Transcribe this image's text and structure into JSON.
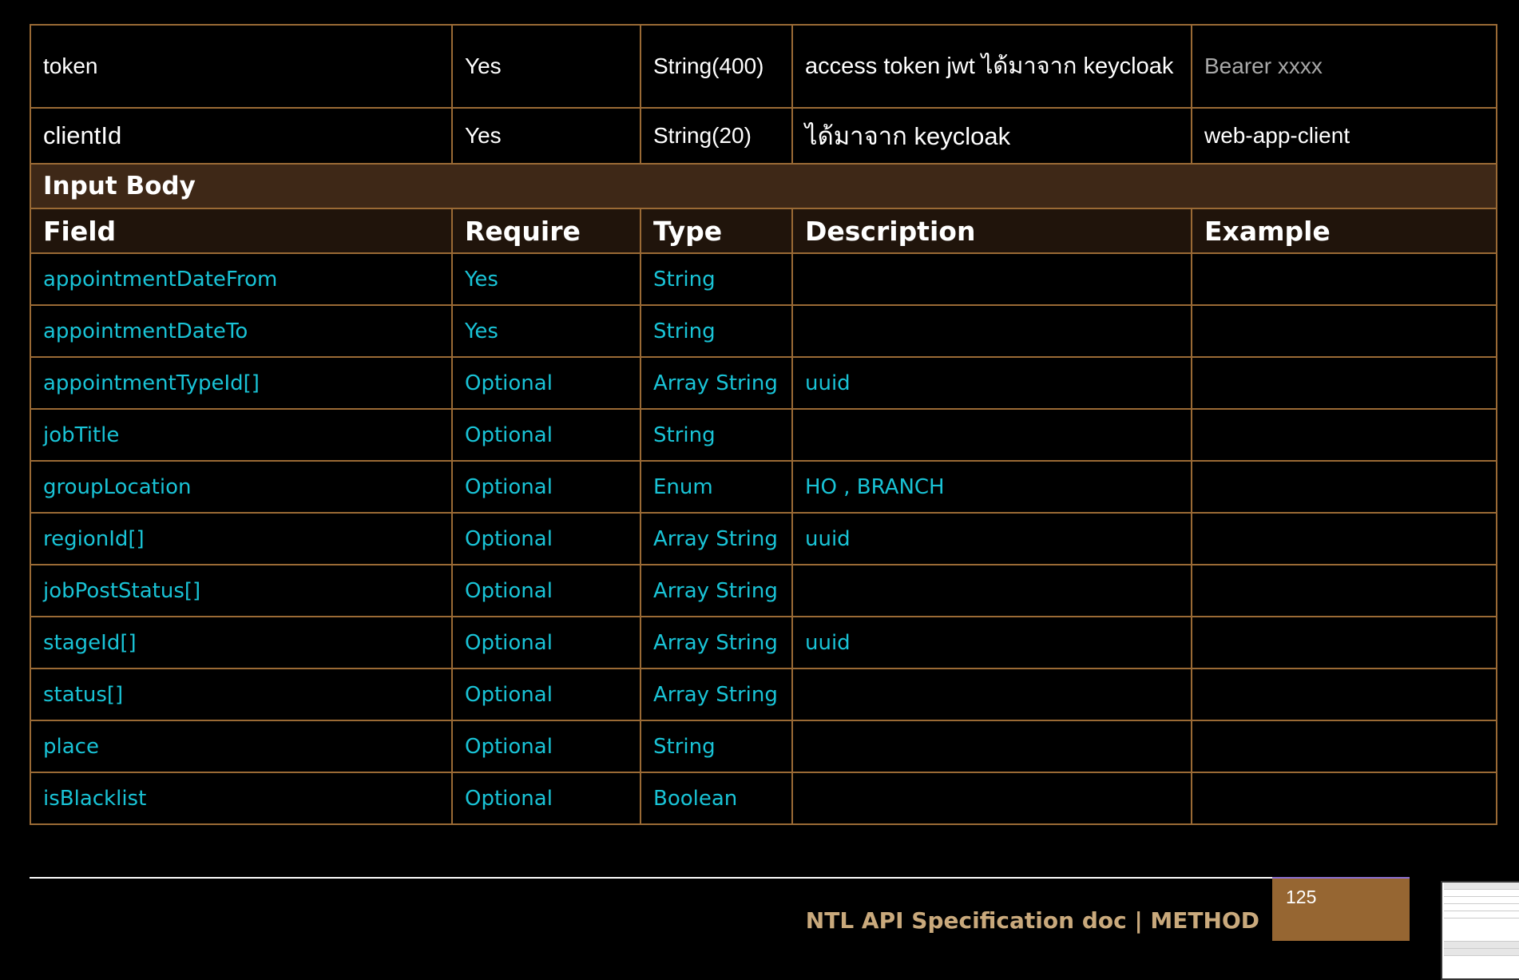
{
  "header_rows": [
    {
      "field": "token",
      "require": "Yes",
      "type": "String(400)",
      "description": "access token jwt ได้มาจาก keycloak",
      "example": "Bearer xxxx"
    },
    {
      "field": "clientId",
      "require": "Yes",
      "type": "String(20)",
      "description": "ได้มาจาก keycloak",
      "example": "web-app-client"
    }
  ],
  "section_title": "Input Body",
  "columns": {
    "field": "Field",
    "require": "Require",
    "type": "Type",
    "description": "Description",
    "example": "Example"
  },
  "rows": [
    {
      "field": "appointmentDateFrom",
      "require": "Yes",
      "type": "String",
      "description": "",
      "example": ""
    },
    {
      "field": "appointmentDateTo",
      "require": "Yes",
      "type": "String",
      "description": "",
      "example": ""
    },
    {
      "field": "appointmentTypeId[]",
      "require": "Optional",
      "type": "Array String",
      "description": "uuid",
      "example": ""
    },
    {
      "field": "jobTitle",
      "require": "Optional",
      "type": "String",
      "description": "",
      "example": ""
    },
    {
      "field": "groupLocation",
      "require": "Optional",
      "type": "Enum",
      "description": "HO , BRANCH",
      "example": ""
    },
    {
      "field": "regionId[]",
      "require": "Optional",
      "type": "Array String",
      "description": "uuid",
      "example": ""
    },
    {
      "field": "jobPostStatus[]",
      "require": "Optional",
      "type": "Array String",
      "description": "",
      "example": ""
    },
    {
      "field": "stageId[]",
      "require": "Optional",
      "type": "Array String",
      "description": "uuid",
      "example": ""
    },
    {
      "field": "status[]",
      "require": "Optional",
      "type": "Array String",
      "description": "",
      "example": ""
    },
    {
      "field": "place",
      "require": "Optional",
      "type": "String",
      "description": "",
      "example": ""
    },
    {
      "field": "isBlacklist",
      "require": "Optional",
      "type": "Boolean",
      "description": "",
      "example": ""
    }
  ],
  "footer": {
    "title": "NTL API Specification doc | METHOD",
    "page_number": "125"
  },
  "colors": {
    "border": "#9a6a35",
    "section_bg": "#3e2817",
    "column_header_bg": "#20140b",
    "field_text": "#19c3d6",
    "footer_title": "#c9a97c",
    "page_box": "#966632"
  }
}
